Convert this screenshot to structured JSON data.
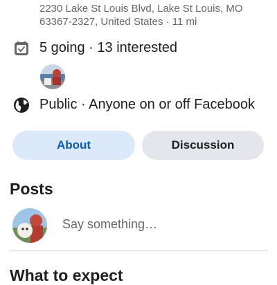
{
  "location": {
    "address": "2230 Lake St Louis Blvd, Lake St Louis, MO 63367-2327, United States · 11 mi"
  },
  "attendance": {
    "icon": "calendar-check-icon",
    "text": "5 going · 13 interested"
  },
  "privacy": {
    "icon": "globe-icon",
    "text": "Public · Anyone on or off Facebook"
  },
  "tabs": [
    {
      "label": "About",
      "active": true
    },
    {
      "label": "Discussion",
      "active": false
    }
  ],
  "posts": {
    "title": "Posts",
    "composer_placeholder": "Say something…"
  },
  "expect": {
    "title": "What to expect"
  },
  "colors": {
    "accent": "#0b5cad",
    "active_tab_bg": "#dbe9fb",
    "inactive_tab_bg": "#e4e6eb",
    "secondary_text": "#65676b"
  }
}
